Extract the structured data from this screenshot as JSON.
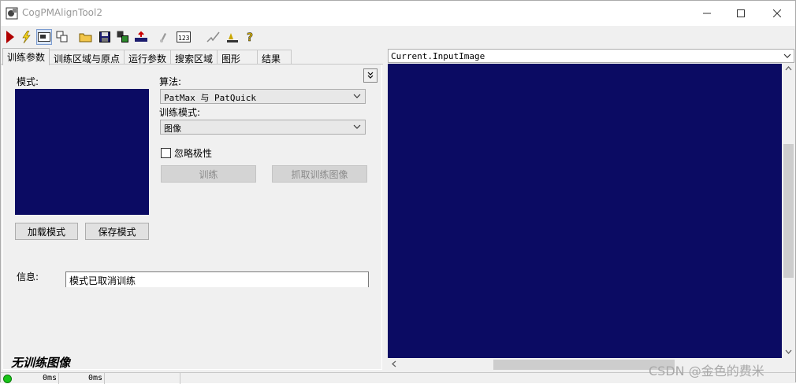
{
  "window": {
    "title": "CogPMAlignTool2"
  },
  "toolbar": {
    "buttons": [
      {
        "name": "run-icon"
      },
      {
        "name": "electric-icon"
      },
      {
        "name": "show-image-icon"
      },
      {
        "name": "local-display-icon"
      },
      {
        "name": "open-icon"
      },
      {
        "name": "save-icon"
      },
      {
        "name": "save-as-icon"
      },
      {
        "name": "reset-icon"
      },
      {
        "name": "check-icon"
      },
      {
        "name": "numbered-icon"
      },
      {
        "name": "edit-icon"
      },
      {
        "name": "level-icon"
      },
      {
        "name": "help-icon"
      }
    ]
  },
  "tabs": [
    {
      "label": "训练参数"
    },
    {
      "label": "训练区域与原点"
    },
    {
      "label": "运行参数"
    },
    {
      "label": "搜索区域"
    },
    {
      "label": "图形"
    },
    {
      "label": "结果"
    }
  ],
  "train_params": {
    "pattern_label": "模式:",
    "algorithm_label": "算法:",
    "algorithm_value": "PatMax 与 PatQuick",
    "train_mode_label": "训练模式:",
    "train_mode_value": "图像",
    "ignore_polarity_label": "忽略极性",
    "train_button": "训练",
    "grab_train_image_button": "抓取训练图像",
    "load_pattern_button": "加载模式",
    "save_pattern_button": "保存模式",
    "info_label": "信息:",
    "info_value": "模式已取消训练",
    "status_message": "无训练图像"
  },
  "image_view": {
    "selected_image": "Current.InputImage"
  },
  "statusbar": {
    "time1": "0ms",
    "time2": "0ms"
  },
  "watermark": "CSDN @金色的费米",
  "colors": {
    "image_background": "#0b0b63",
    "status_led": "#19c519"
  }
}
